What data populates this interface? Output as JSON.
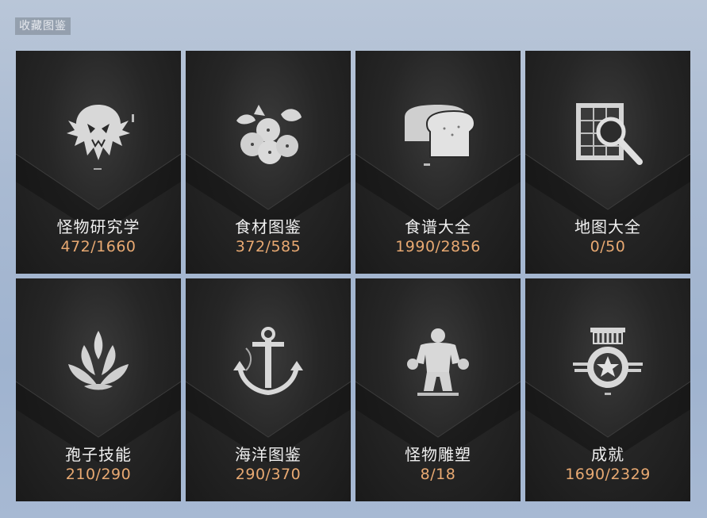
{
  "header": {
    "title": "收藏图鉴"
  },
  "cards": [
    {
      "name": "怪物研究学",
      "count": "472/1660",
      "icon": "monster-skull-icon"
    },
    {
      "name": "食材图鉴",
      "count": "372/585",
      "icon": "berries-icon"
    },
    {
      "name": "食谱大全",
      "count": "1990/2856",
      "icon": "bread-icon"
    },
    {
      "name": "地图大全",
      "count": "0/50",
      "icon": "map-magnifier-icon"
    },
    {
      "name": "孢子技能",
      "count": "210/290",
      "icon": "spore-flame-icon"
    },
    {
      "name": "海洋图鉴",
      "count": "290/370",
      "icon": "anchor-icon"
    },
    {
      "name": "怪物雕塑",
      "count": "8/18",
      "icon": "monster-statue-icon"
    },
    {
      "name": "成就",
      "count": "1690/2329",
      "icon": "medal-star-icon"
    }
  ],
  "colors": {
    "count_text": "#e8a972",
    "name_text": "#f0f0f0",
    "card_bg": "#262626"
  }
}
